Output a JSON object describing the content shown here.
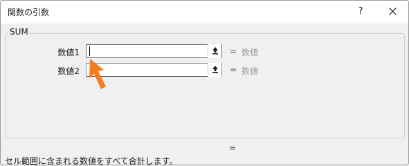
{
  "window": {
    "title": "関数の引数",
    "help_label": "?"
  },
  "function": {
    "name": "SUM",
    "arguments": [
      {
        "label": "数値1",
        "value": "",
        "result_equals": "=",
        "result_hint": "数値"
      },
      {
        "label": "数値2",
        "value": "",
        "result_equals": "=",
        "result_hint": "数値"
      }
    ],
    "formula_equals": "=",
    "description": "セル範囲に含まれる数値をすべて合計します。"
  },
  "colors": {
    "pointer_arrow": "#f57c1f",
    "hint_text": "#9a9a9a"
  },
  "icons": {
    "collapse": "collapse-dialog-icon",
    "close": "close-icon",
    "pointer": "pointer-arrow-icon"
  }
}
